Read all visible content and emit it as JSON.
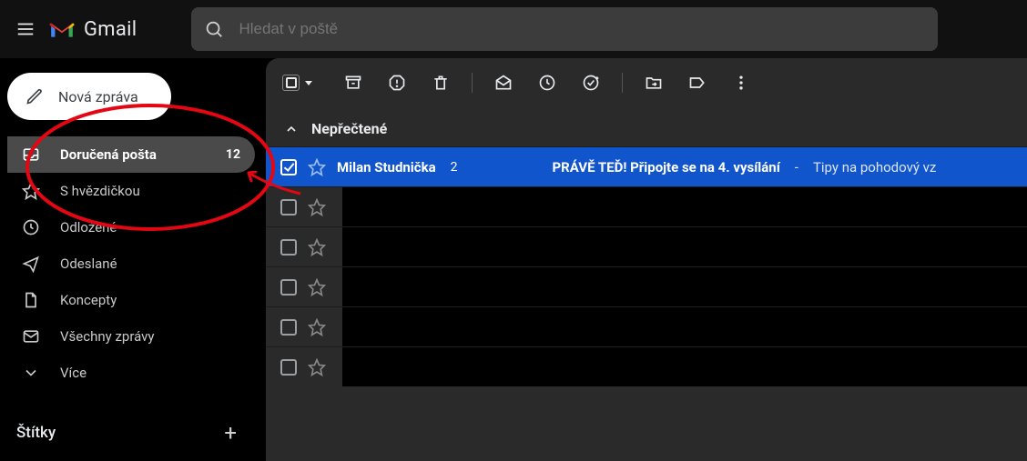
{
  "header": {
    "app_name": "Gmail",
    "search_placeholder": "Hledat v poště"
  },
  "compose_label": "Nová zpráva",
  "sidebar": {
    "items": [
      {
        "label": "Doručená pošta",
        "count": "12"
      },
      {
        "label": "S hvězdičkou"
      },
      {
        "label": "Odložené"
      },
      {
        "label": "Odeslané"
      },
      {
        "label": "Koncepty"
      },
      {
        "label": "Všechny zprávy"
      },
      {
        "label": "Více"
      }
    ],
    "labels_title": "Štítky"
  },
  "main": {
    "section_title": "Nepřečtené",
    "selected_row": {
      "sender": "Milan Studnička",
      "thread_count": "2",
      "subject": "PRÁVĚ TEĎ! Připojte se na 4. vysílání",
      "snippet_prefix": " - ",
      "snippet": "Tipy na pohodový vz"
    }
  },
  "icons": {
    "archive": "archive",
    "report": "report",
    "delete": "delete",
    "mark_unread": "mark-unread",
    "snooze": "snooze",
    "add_task": "add-task",
    "move": "move",
    "label": "label",
    "more": "more"
  }
}
